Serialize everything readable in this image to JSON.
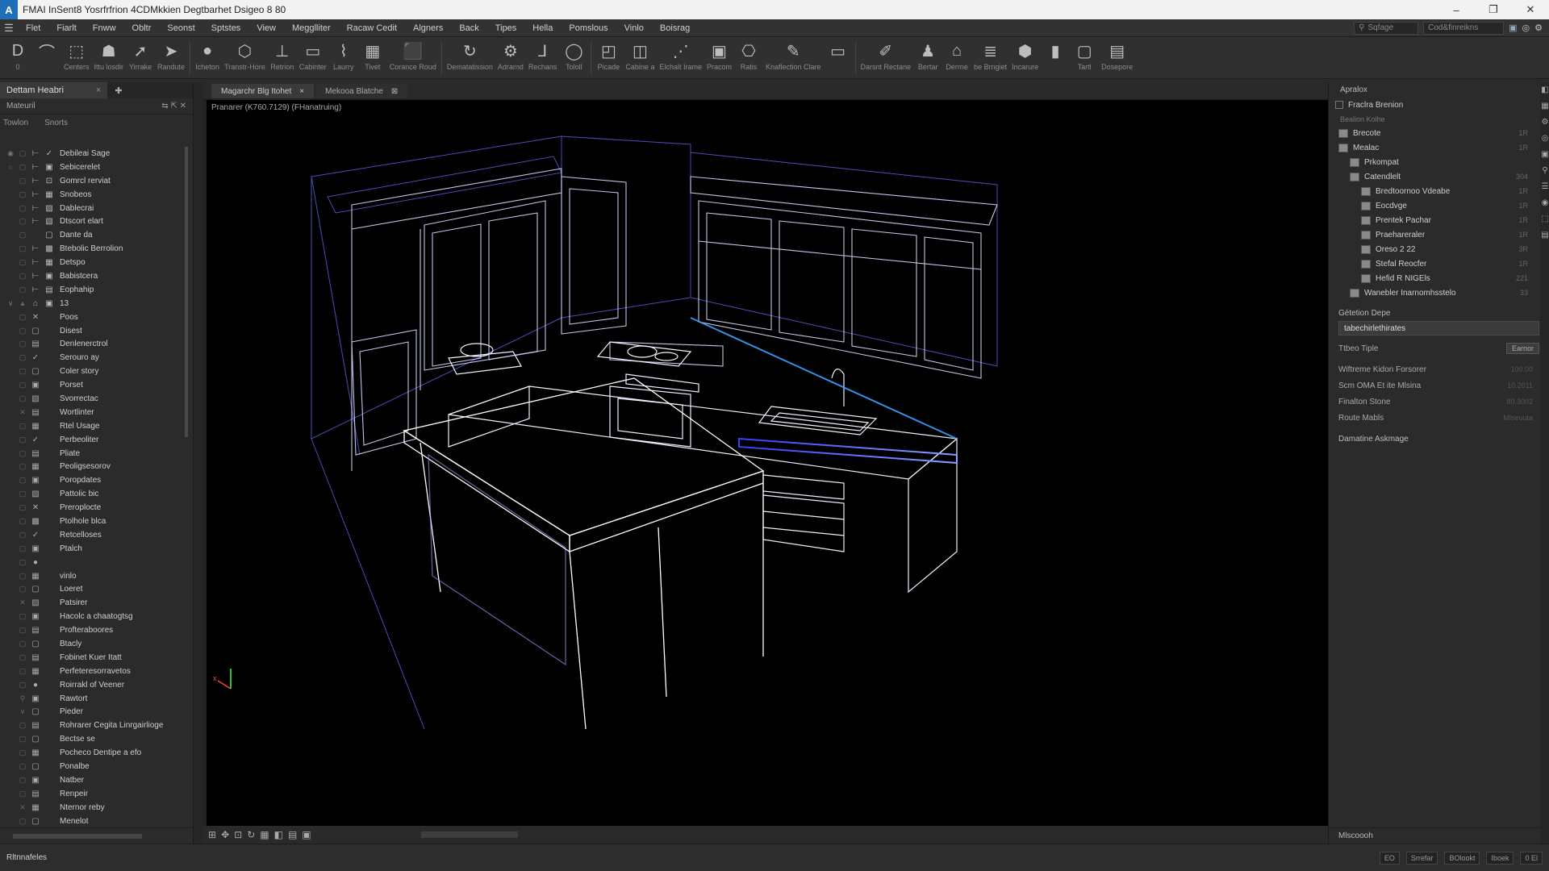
{
  "window": {
    "logo": "A",
    "title": "FMAI InSent8 Yosrfrfrion 4CDMkkien Degtbarhet Dsigeo 8 80",
    "controls": [
      "–",
      "❐",
      "✕"
    ]
  },
  "menu": {
    "items": [
      "Flet",
      "Fiarlt",
      "Fnww",
      "Obltr",
      "Seonst",
      "Sptstes",
      "View",
      "Megglliter",
      "Racaw Cedit",
      "Algners",
      "Back",
      "Tipes",
      "Hella",
      "Pomslous",
      "Vinlo",
      "Boisrag"
    ],
    "search_placeholder": "Sqfage",
    "account_label": "Cod&finreikns"
  },
  "toolbar": {
    "tools": [
      {
        "icon": "pointer-icon",
        "glyph": "D",
        "label": "0"
      },
      {
        "icon": "curve-icon",
        "glyph": "⌒",
        "label": ""
      },
      {
        "icon": "select-icon",
        "glyph": "⬚",
        "label": "Centers"
      },
      {
        "icon": "hat-icon",
        "glyph": "☗",
        "label": "Ittu losdir"
      },
      {
        "icon": "arrow-icon",
        "glyph": "➚",
        "label": "Yirrake"
      },
      {
        "icon": "cursor-icon",
        "glyph": "➤",
        "label": "Randute"
      },
      {
        "icon": "sphere-icon",
        "glyph": "●",
        "label": "Icheton"
      },
      {
        "icon": "cube-icon",
        "glyph": "⬡",
        "label": "Transtr-Hore"
      },
      {
        "icon": "wrench-icon",
        "glyph": "⊥",
        "label": "Retrion"
      },
      {
        "icon": "cabinet-icon",
        "glyph": "▭",
        "label": "Cabinter"
      },
      {
        "icon": "link-icon",
        "glyph": "⌇",
        "label": "Laurry"
      },
      {
        "icon": "grid-icon",
        "glyph": "▦",
        "label": "Tivet"
      },
      {
        "icon": "box-icon",
        "glyph": "⬛",
        "label": "Corance Roud"
      },
      {
        "icon": "rotate-icon",
        "glyph": "↻",
        "label": "Dematatission"
      },
      {
        "icon": "gear-icon",
        "glyph": "⚙",
        "label": "Adrarnd"
      },
      {
        "icon": "hook-icon",
        "glyph": "⅃",
        "label": "Rechans"
      },
      {
        "icon": "ring-icon",
        "glyph": "◯",
        "label": "Tololl"
      },
      {
        "icon": "place-icon",
        "glyph": "◰",
        "label": "Picade"
      },
      {
        "icon": "frame-icon",
        "glyph": "◫",
        "label": "Cabine a"
      },
      {
        "icon": "array-icon",
        "glyph": "⋰",
        "label": "Elchalt Irame"
      },
      {
        "icon": "render-icon",
        "glyph": "▣",
        "label": "Pracom"
      },
      {
        "icon": "camera-icon",
        "glyph": "⎔",
        "label": "Ratis"
      },
      {
        "icon": "edit-icon",
        "glyph": "✎",
        "label": "Knaflection Clare"
      },
      {
        "icon": "monitor-icon",
        "glyph": "▭",
        "label": ""
      },
      {
        "icon": "pen-icon",
        "glyph": "✐",
        "label": "Darsnt Rectane"
      },
      {
        "icon": "person-icon",
        "glyph": "♟",
        "label": "Bertar"
      },
      {
        "icon": "roof-icon",
        "glyph": "⌂",
        "label": "Derrne"
      },
      {
        "icon": "layers-icon",
        "glyph": "≣",
        "label": "be Brngiet"
      },
      {
        "icon": "shield-icon",
        "glyph": "⬢",
        "label": "Incarure"
      },
      {
        "icon": "lock-icon",
        "glyph": "▮",
        "label": ""
      },
      {
        "icon": "window-icon",
        "glyph": "▢",
        "label": "Tartl"
      },
      {
        "icon": "tile-icon",
        "glyph": "▤",
        "label": "Dosepore"
      }
    ]
  },
  "left_panel": {
    "tab_label": "Dettam Heabri",
    "header_label": "Mateuril",
    "sub_left": "Towlon",
    "sub_right": "Snorts",
    "rows": [
      {
        "eye": "◉",
        "lock": "▢",
        "type": "⊢",
        "icon": "✓",
        "label": "Debileai Sage"
      },
      {
        "eye": "○",
        "lock": "▢",
        "type": "⊢",
        "icon": "▣",
        "label": "Sebicerelet"
      },
      {
        "eye": "",
        "lock": "▢",
        "type": "⊢",
        "icon": "⊡",
        "label": "Gomrcl rerviat"
      },
      {
        "eye": "",
        "lock": "▢",
        "type": "⊢",
        "icon": "▦",
        "label": "Snobeos"
      },
      {
        "eye": "",
        "lock": "▢",
        "type": "⊢",
        "icon": "▨",
        "label": "Dablecrai"
      },
      {
        "eye": "",
        "lock": "▢",
        "type": "⊢",
        "icon": "▧",
        "label": "Dtscort elart"
      },
      {
        "eye": "",
        "lock": "▢",
        "type": "",
        "icon": "▢",
        "label": "Dante da"
      },
      {
        "eye": "",
        "lock": "▢",
        "type": "⊢",
        "icon": "▩",
        "label": "Btebolic Berrolion"
      },
      {
        "eye": "",
        "lock": "▢",
        "type": "⊢",
        "icon": "▦",
        "label": "Detspo"
      },
      {
        "eye": "",
        "lock": "▢",
        "type": "⊢",
        "icon": "▣",
        "label": "Babistcera"
      },
      {
        "eye": "",
        "lock": "▢",
        "type": "⊢",
        "icon": "▤",
        "label": "Eophahip"
      },
      {
        "eye": "∨",
        "lock": "▲",
        "type": "⌂",
        "icon": "▣",
        "label": "13"
      },
      {
        "eye": "",
        "lock": "▢",
        "type": "✕",
        "icon": "",
        "label": "Poos"
      },
      {
        "eye": "",
        "lock": "▢",
        "type": "▢",
        "icon": "",
        "label": "Disest"
      },
      {
        "eye": "",
        "lock": "▢",
        "type": "▤",
        "icon": "",
        "label": "Denlenerctrol"
      },
      {
        "eye": "",
        "lock": "▢",
        "type": "✓",
        "icon": "",
        "label": "Serouro ay"
      },
      {
        "eye": "",
        "lock": "▢",
        "type": "▢",
        "icon": "",
        "label": "Coler story"
      },
      {
        "eye": "",
        "lock": "▢",
        "type": "▣",
        "icon": "",
        "label": "Porset"
      },
      {
        "eye": "",
        "lock": "▢",
        "type": "▧",
        "icon": "",
        "label": "Svorrectac"
      },
      {
        "eye": "",
        "lock": "✕",
        "type": "▤",
        "icon": "",
        "label": "Wortlinter"
      },
      {
        "eye": "",
        "lock": "▢",
        "type": "▦",
        "icon": "",
        "label": "Rtel Usage"
      },
      {
        "eye": "",
        "lock": "▢",
        "type": "✓",
        "icon": "",
        "label": "Perbeoliter"
      },
      {
        "eye": "",
        "lock": "▢",
        "type": "▤",
        "icon": "",
        "label": "Pliate"
      },
      {
        "eye": "",
        "lock": "▢",
        "type": "▦",
        "icon": "",
        "label": "Peoligsesorov"
      },
      {
        "eye": "",
        "lock": "▢",
        "type": "▣",
        "icon": "",
        "label": "Poropdates"
      },
      {
        "eye": "",
        "lock": "▢",
        "type": "▨",
        "icon": "",
        "label": "Pattolic bic"
      },
      {
        "eye": "",
        "lock": "▢",
        "type": "✕",
        "icon": "",
        "label": "Preroplocte"
      },
      {
        "eye": "",
        "lock": "▢",
        "type": "▩",
        "icon": "",
        "label": "Ptolhole blca"
      },
      {
        "eye": "",
        "lock": "▢",
        "type": "✓",
        "icon": "",
        "label": "Retcelloses"
      },
      {
        "eye": "",
        "lock": "▢",
        "type": "▣",
        "icon": "",
        "label": "Ptalch"
      },
      {
        "eye": "",
        "lock": "▢",
        "type": "●",
        "icon": "",
        "label": ""
      },
      {
        "eye": "",
        "lock": "▢",
        "type": "▦",
        "icon": "",
        "label": "vinlo"
      },
      {
        "eye": "",
        "lock": "▢",
        "type": "▢",
        "icon": "",
        "label": "Loeret"
      },
      {
        "eye": "",
        "lock": "✕",
        "type": "▧",
        "icon": "",
        "label": "Patsirer"
      },
      {
        "eye": "",
        "lock": "▢",
        "type": "▣",
        "icon": "",
        "label": "Hacolc a chaatogtsg"
      },
      {
        "eye": "",
        "lock": "▢",
        "type": "▤",
        "icon": "",
        "label": "Profteraboores"
      },
      {
        "eye": "",
        "lock": "▢",
        "type": "▢",
        "icon": "",
        "label": "Btacly"
      },
      {
        "eye": "",
        "lock": "▢",
        "type": "▤",
        "icon": "",
        "label": "Fobinet Kuer Itatt"
      },
      {
        "eye": "",
        "lock": "▢",
        "type": "▦",
        "icon": "",
        "label": "Perfeteresorravetos"
      },
      {
        "eye": "",
        "lock": "▢",
        "type": "●",
        "icon": "",
        "label": "Roirrakl of Veener"
      },
      {
        "eye": "",
        "lock": "⚲",
        "type": "▣",
        "icon": "",
        "label": "Rawtort"
      },
      {
        "eye": "",
        "lock": "∨",
        "type": "▢",
        "icon": "",
        "label": "Pieder"
      },
      {
        "eye": "",
        "lock": "▢",
        "type": "▤",
        "icon": "",
        "label": "Rohrarer Cegita Linrgairlioge"
      },
      {
        "eye": "",
        "lock": "▢",
        "type": "▢",
        "icon": "",
        "label": "Bectse se"
      },
      {
        "eye": "",
        "lock": "▢",
        "type": "▦",
        "icon": "",
        "label": "Pocheco Dentipe a efo"
      },
      {
        "eye": "",
        "lock": "▢",
        "type": "▢",
        "icon": "",
        "label": "Ponalbe"
      },
      {
        "eye": "",
        "lock": "▢",
        "type": "▣",
        "icon": "",
        "label": "Natber"
      },
      {
        "eye": "",
        "lock": "▢",
        "type": "▤",
        "icon": "",
        "label": "Renpeir"
      },
      {
        "eye": "",
        "lock": "✕",
        "type": "▦",
        "icon": "",
        "label": "Nternor reby"
      },
      {
        "eye": "",
        "lock": "▢",
        "type": "▢",
        "icon": "",
        "label": "Menelot"
      }
    ]
  },
  "viewport": {
    "tabs": [
      {
        "label": "Magarchr Blg Itohet",
        "close": "×"
      },
      {
        "label": "Mekooa Blatche",
        "close": "⊠"
      }
    ],
    "info": "Pranarer (K760.7129) (FHanatruing)",
    "axis_label": "x"
  },
  "right_panel": {
    "title": "Apralox",
    "subtitle": "Fraclra Brenion",
    "caption": "Bealion Kolhe",
    "items": [
      {
        "indent": 0,
        "label": "Brecote",
        "value": "1R"
      },
      {
        "indent": 0,
        "label": "Mealac",
        "value": "1R"
      },
      {
        "indent": 1,
        "label": "Prkompat",
        "value": ""
      },
      {
        "indent": 1,
        "label": "Catendlelt",
        "value": "304"
      },
      {
        "indent": 2,
        "label": "Bredtoornoo Vdeabe",
        "value": "1R"
      },
      {
        "indent": 2,
        "label": "Eocdvge",
        "value": "1R"
      },
      {
        "indent": 2,
        "label": "Prentek Pachar",
        "value": "1R"
      },
      {
        "indent": 2,
        "label": "Praehareraler",
        "value": "1R"
      },
      {
        "indent": 2,
        "label": "Oreso 2 22",
        "value": "3R"
      },
      {
        "indent": 2,
        "label": "Stefal Reocfer",
        "value": "1R"
      },
      {
        "indent": 2,
        "label": "Hefid R NIGEls",
        "value": "221"
      },
      {
        "indent": 1,
        "label": "Wanebler Inarnomhsstelo",
        "value": "33"
      }
    ],
    "section1": "Gétetion Depe",
    "input_value": "tabechirlethirates",
    "field_type_label": "Ttbeo Tiple",
    "field_type_button": "Earnor",
    "fields": [
      {
        "label": "Wiftreme Kidon Forsorer",
        "value": "100.00"
      },
      {
        "label": "Scm OMA   Et ite Mlsina",
        "value": "10.2011"
      },
      {
        "label": "Finalton Stone",
        "value": "80.3002"
      },
      {
        "label": "Route Mabls",
        "value": "Mlseuuta"
      }
    ],
    "section2": "Damatine Askmage",
    "footer": "Mlscoooh"
  },
  "status": {
    "left": "Rltnnafeles",
    "fields": [
      "EO",
      "Srrefar",
      "BOlookt",
      "Iboek",
      "0 El"
    ]
  }
}
